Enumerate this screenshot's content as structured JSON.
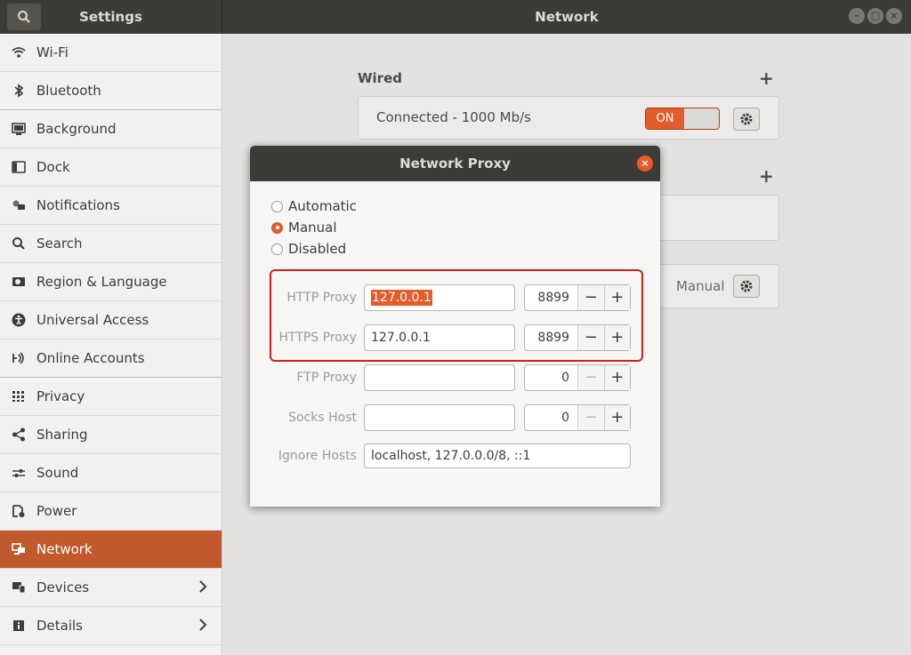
{
  "window": {
    "left_title": "Settings",
    "right_title": "Network"
  },
  "sidebar": {
    "items": [
      {
        "label": "Wi-Fi",
        "icon": "wifi-icon"
      },
      {
        "label": "Bluetooth",
        "icon": "bluetooth-icon"
      },
      {
        "label": "Background",
        "icon": "background-icon"
      },
      {
        "label": "Dock",
        "icon": "dock-icon"
      },
      {
        "label": "Notifications",
        "icon": "notifications-icon"
      },
      {
        "label": "Search",
        "icon": "search-icon"
      },
      {
        "label": "Region & Language",
        "icon": "region-icon"
      },
      {
        "label": "Universal Access",
        "icon": "universal-access-icon"
      },
      {
        "label": "Online Accounts",
        "icon": "online-accounts-icon"
      },
      {
        "label": "Privacy",
        "icon": "privacy-icon"
      },
      {
        "label": "Sharing",
        "icon": "sharing-icon"
      },
      {
        "label": "Sound",
        "icon": "sound-icon"
      },
      {
        "label": "Power",
        "icon": "power-icon"
      },
      {
        "label": "Network",
        "icon": "network-icon",
        "active": true
      },
      {
        "label": "Devices",
        "icon": "devices-icon"
      },
      {
        "label": "Details",
        "icon": "details-icon"
      }
    ]
  },
  "main": {
    "wired_title": "Wired",
    "wired_status": "Connected - 1000 Mb/s",
    "toggle_label": "ON",
    "proxy_mode": "Manual"
  },
  "dialog": {
    "title": "Network Proxy",
    "radios": {
      "automatic": "Automatic",
      "manual": "Manual",
      "disabled": "Disabled"
    },
    "fields": {
      "http": {
        "label": "HTTP Proxy",
        "host": "127.0.0.1",
        "port": "8899"
      },
      "https": {
        "label": "HTTPS Proxy",
        "host": "127.0.0.1",
        "port": "8899"
      },
      "ftp": {
        "label": "FTP Proxy",
        "host": "",
        "port": "0"
      },
      "socks": {
        "label": "Socks Host",
        "host": "",
        "port": "0"
      },
      "ignore": {
        "label": "Ignore Hosts",
        "value": "localhost, 127.0.0.0/8, ::1"
      }
    },
    "spin_minus": "−",
    "spin_plus": "+"
  },
  "colors": {
    "accent": "#e35c2c",
    "titlebar": "#3c3b37",
    "highlight": "#d32020"
  }
}
